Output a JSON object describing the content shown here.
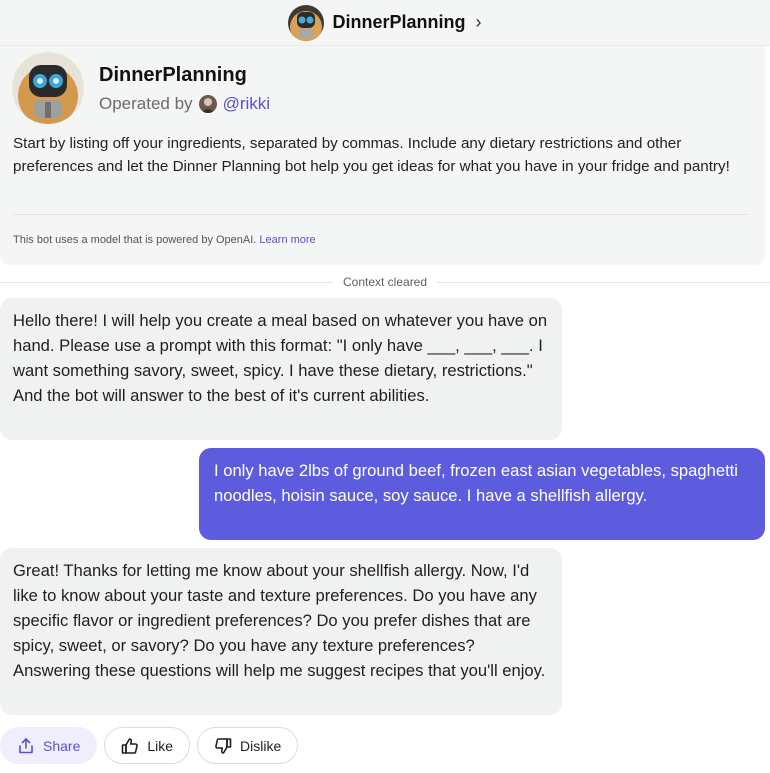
{
  "header": {
    "title": "DinnerPlanning",
    "chevron": "›",
    "avatar_icon": "robot-avatar-icon"
  },
  "bot": {
    "name": "DinnerPlanning",
    "operated_by_label": "Operated by",
    "operator_handle": "@rikki",
    "description": "Start by listing off your ingredients, separated by commas. Include any dietary restrictions and other preferences and let the Dinner Planning bot help you get ideas for what you have in your fridge and pantry!",
    "powered_text": "This bot uses a model that is powered by OpenAI.",
    "learn_more": "Learn more"
  },
  "context_cleared": "Context cleared",
  "messages": [
    {
      "role": "bot",
      "text": "Hello there! I will help you create a meal based on whatever you have on hand. Please use a prompt with this format: \"I only have ___, ___, ___. I want something savory, sweet, spicy. I have these dietary, restrictions.\" And the bot will answer to the best of it's current abilities."
    },
    {
      "role": "user",
      "text": "I only have 2lbs of ground beef, frozen east asian vegetables, spaghetti noodles, hoisin sauce, soy sauce. I have a shellfish allergy."
    },
    {
      "role": "bot",
      "text": "Great! Thanks for letting me know about your shellfish allergy. Now, I'd like to know about your taste and texture preferences. Do you have any specific flavor or ingredient preferences? Do you prefer dishes that are spicy, sweet, or savory? Do you have any texture preferences? Answering these questions will help me suggest recipes that you'll enjoy."
    }
  ],
  "actions": {
    "share": "Share",
    "like": "Like",
    "dislike": "Dislike"
  },
  "colors": {
    "accent": "#5b4fd3",
    "user_bubble": "#5d5cde",
    "bot_bubble": "#f0f1f1",
    "panel": "#f4f5f5"
  }
}
